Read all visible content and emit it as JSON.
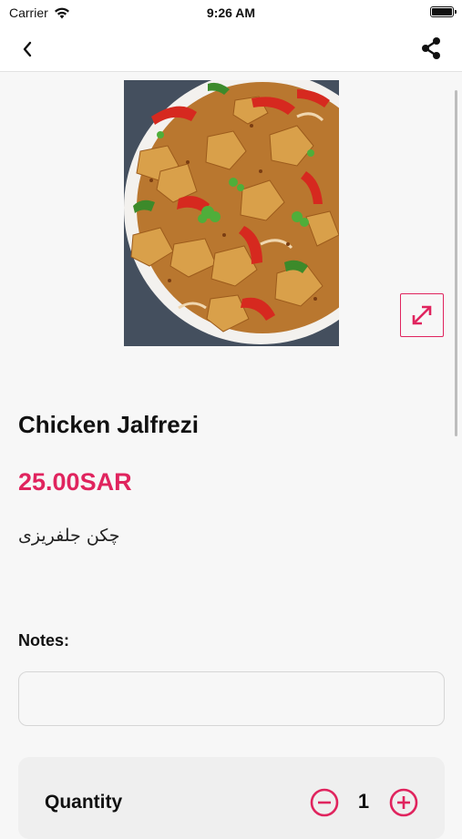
{
  "status_bar": {
    "carrier": "Carrier",
    "time": "9:26 AM",
    "icons": [
      "wifi-icon",
      "battery-icon"
    ]
  },
  "nav": {
    "back_icon": "chevron-left-icon",
    "share_icon": "share-icon"
  },
  "item": {
    "image_alt": "Chicken Jalfrezi",
    "name": "Chicken Jalfrezi",
    "price": "25.00SAR",
    "name_secondary": "چکن جلفریزی",
    "expand_icon": "expand-arrows-icon"
  },
  "notes": {
    "label": "Notes:",
    "value": "",
    "placeholder": ""
  },
  "quantity": {
    "label": "Quantity",
    "value": "1",
    "minus_icon": "minus-circle-icon",
    "plus_icon": "plus-circle-icon"
  },
  "colors": {
    "accent": "#e0245e",
    "background": "#f7f7f7",
    "card": "#efefef"
  }
}
